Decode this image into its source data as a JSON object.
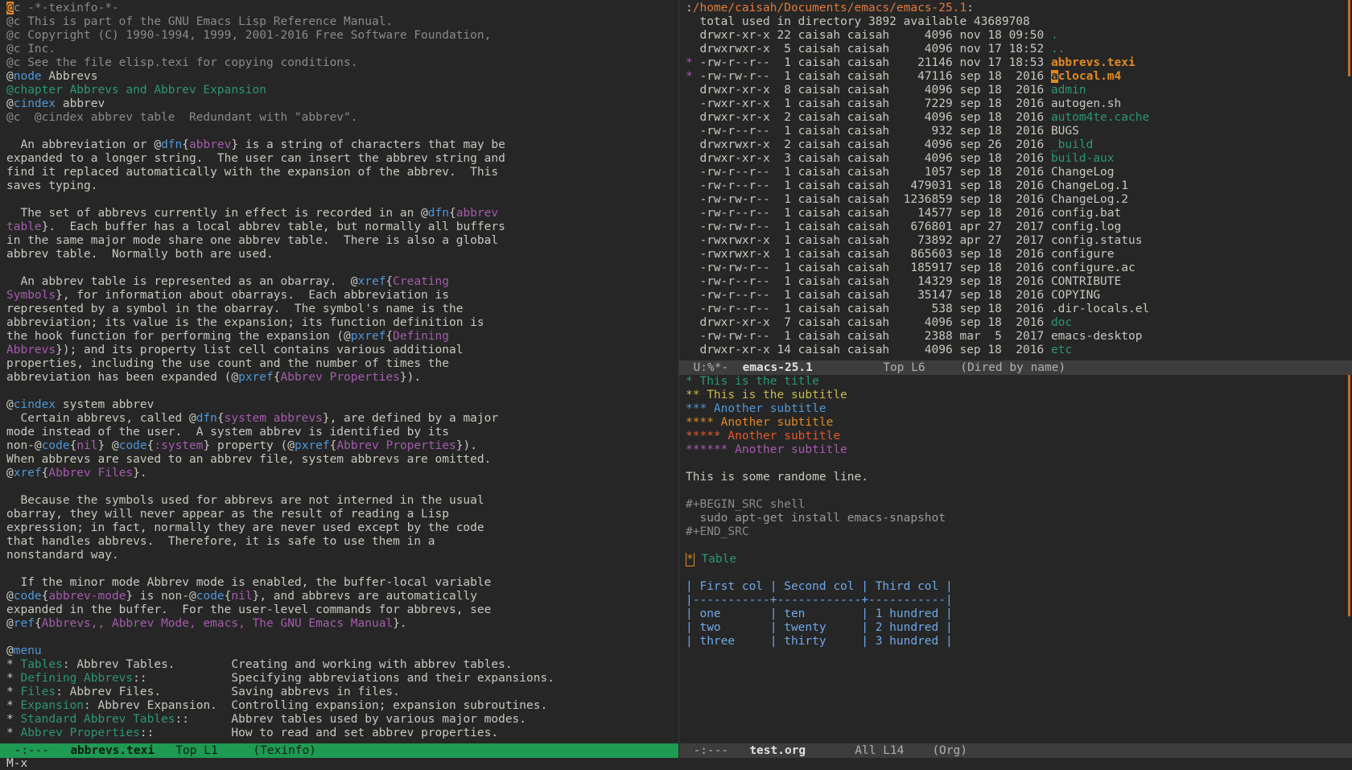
{
  "left_buffer": {
    "lines": [
      [
        [
          "@",
          "c-cursor"
        ],
        [
          "c -*-texinfo-*-",
          "c-comment"
        ]
      ],
      [
        [
          "@c This is part of the GNU Emacs Lisp Reference Manual.",
          "c-comment"
        ]
      ],
      [
        [
          "@c Copyright (C) 1990-1994, 1999, 2001-2016 Free Software Foundation,",
          "c-comment"
        ]
      ],
      [
        [
          "@c Inc.",
          "c-comment"
        ]
      ],
      [
        [
          "@c See the file elisp.texi for copying conditions.",
          "c-comment"
        ]
      ],
      [
        [
          "@",
          ""
        ],
        [
          "node",
          "c-kw"
        ],
        [
          " Abbrevs",
          ""
        ]
      ],
      [
        [
          "@chapter Abbrevs and Abbrev Expansion",
          "c-green"
        ]
      ],
      [
        [
          "@",
          ""
        ],
        [
          "cindex",
          "c-kw"
        ],
        [
          " abbrev",
          ""
        ]
      ],
      [
        [
          "@c  @cindex abbrev table  Redundant with \"abbrev\".",
          "c-comment"
        ]
      ],
      [
        [
          "",
          ""
        ]
      ],
      [
        [
          "  An abbreviation or @",
          ""
        ],
        [
          "dfn",
          "c-kw"
        ],
        [
          "{",
          ""
        ],
        [
          "abbrev",
          "c-purple"
        ],
        [
          "} is a string of characters that may be",
          ""
        ]
      ],
      [
        [
          "expanded to a longer string.  The user can insert the abbrev string and",
          ""
        ]
      ],
      [
        [
          "find it replaced automatically with the expansion of the abbrev.  This",
          ""
        ]
      ],
      [
        [
          "saves typing.",
          ""
        ]
      ],
      [
        [
          "",
          ""
        ]
      ],
      [
        [
          "  The set of abbrevs currently in effect is recorded in an @",
          ""
        ],
        [
          "dfn",
          "c-kw"
        ],
        [
          "{",
          ""
        ],
        [
          "abbrev",
          "c-purple"
        ]
      ],
      [
        [
          "table",
          "c-purple"
        ],
        [
          "}.  Each buffer has a local abbrev table, but normally all buffers",
          ""
        ]
      ],
      [
        [
          "in the same major mode share one abbrev table.  There is also a global",
          ""
        ]
      ],
      [
        [
          "abbrev table.  Normally both are used.",
          ""
        ]
      ],
      [
        [
          "",
          ""
        ]
      ],
      [
        [
          "  An abbrev table is represented as an obarray.  @",
          ""
        ],
        [
          "xref",
          "c-kw"
        ],
        [
          "{",
          ""
        ],
        [
          "Creating",
          "c-purple"
        ]
      ],
      [
        [
          "Symbols",
          "c-purple"
        ],
        [
          "}, for information about obarrays.  Each abbreviation is",
          ""
        ]
      ],
      [
        [
          "represented by a symbol in the obarray.  The symbol's name is the",
          ""
        ]
      ],
      [
        [
          "abbreviation; its value is the expansion; its function definition is",
          ""
        ]
      ],
      [
        [
          "the hook function for performing the expansion (@",
          ""
        ],
        [
          "pxref",
          "c-kw"
        ],
        [
          "{",
          ""
        ],
        [
          "Defining",
          "c-purple"
        ]
      ],
      [
        [
          "Abbrevs",
          "c-purple"
        ],
        [
          "}); and its property list cell contains various additional",
          ""
        ]
      ],
      [
        [
          "properties, including the use count and the number of times the",
          ""
        ]
      ],
      [
        [
          "abbreviation has been expanded (@",
          ""
        ],
        [
          "pxref",
          "c-kw"
        ],
        [
          "{",
          ""
        ],
        [
          "Abbrev Properties",
          "c-purple"
        ],
        [
          "}).",
          ""
        ]
      ],
      [
        [
          "",
          ""
        ]
      ],
      [
        [
          "@",
          ""
        ],
        [
          "cindex",
          "c-kw"
        ],
        [
          " system abbrev",
          ""
        ]
      ],
      [
        [
          "  Certain abbrevs, called @",
          ""
        ],
        [
          "dfn",
          "c-kw"
        ],
        [
          "{",
          ""
        ],
        [
          "system abbrevs",
          "c-purple"
        ],
        [
          "}, are defined by a major",
          ""
        ]
      ],
      [
        [
          "mode instead of the user.  A system abbrev is identified by its",
          ""
        ]
      ],
      [
        [
          "non-@",
          ""
        ],
        [
          "code",
          "c-kw"
        ],
        [
          "{",
          ""
        ],
        [
          "nil",
          "c-purple"
        ],
        [
          "} @",
          ""
        ],
        [
          "code",
          "c-kw"
        ],
        [
          "{",
          ""
        ],
        [
          ":system",
          "c-purple"
        ],
        [
          "} property (@",
          ""
        ],
        [
          "pxref",
          "c-kw"
        ],
        [
          "{",
          ""
        ],
        [
          "Abbrev Properties",
          "c-purple"
        ],
        [
          "}).",
          ""
        ]
      ],
      [
        [
          "When abbrevs are saved to an abbrev file, system abbrevs are omitted.",
          ""
        ]
      ],
      [
        [
          "@",
          ""
        ],
        [
          "xref",
          "c-kw"
        ],
        [
          "{",
          ""
        ],
        [
          "Abbrev Files",
          "c-purple"
        ],
        [
          "}.",
          ""
        ]
      ],
      [
        [
          "",
          ""
        ]
      ],
      [
        [
          "  Because the symbols used for abbrevs are not interned in the usual",
          ""
        ]
      ],
      [
        [
          "obarray, they will never appear as the result of reading a Lisp",
          ""
        ]
      ],
      [
        [
          "expression; in fact, normally they are never used except by the code",
          ""
        ]
      ],
      [
        [
          "that handles abbrevs.  Therefore, it is safe to use them in a",
          ""
        ]
      ],
      [
        [
          "nonstandard way.",
          ""
        ]
      ],
      [
        [
          "",
          ""
        ]
      ],
      [
        [
          "  If the minor mode Abbrev mode is enabled, the buffer-local variable",
          ""
        ]
      ],
      [
        [
          "@",
          ""
        ],
        [
          "code",
          "c-kw"
        ],
        [
          "{",
          ""
        ],
        [
          "abbrev-mode",
          "c-purple"
        ],
        [
          "} is non-@",
          ""
        ],
        [
          "code",
          "c-kw"
        ],
        [
          "{",
          ""
        ],
        [
          "nil",
          "c-purple"
        ],
        [
          "}, and abbrevs are automatically",
          ""
        ]
      ],
      [
        [
          "expanded in the buffer.  For the user-level commands for abbrevs, see",
          ""
        ]
      ],
      [
        [
          "@",
          ""
        ],
        [
          "ref",
          "c-kw"
        ],
        [
          "{",
          ""
        ],
        [
          "Abbrevs,, Abbrev Mode, emacs, The GNU Emacs Manual",
          "c-purple"
        ],
        [
          "}.",
          ""
        ]
      ],
      [
        [
          "",
          ""
        ]
      ],
      [
        [
          "@",
          ""
        ],
        [
          "menu",
          "c-kw"
        ]
      ],
      [
        [
          "* ",
          ""
        ],
        [
          "Tables",
          "c-green"
        ],
        [
          ": Abbrev Tables.        Creating and working with abbrev tables.",
          ""
        ]
      ],
      [
        [
          "* ",
          ""
        ],
        [
          "Defining Abbrevs",
          "c-green"
        ],
        [
          "::            Specifying abbreviations and their expansions.",
          ""
        ]
      ],
      [
        [
          "* ",
          ""
        ],
        [
          "Files",
          "c-green"
        ],
        [
          ": Abbrev Files.          Saving abbrevs in files.",
          ""
        ]
      ],
      [
        [
          "* ",
          ""
        ],
        [
          "Expansion",
          "c-green"
        ],
        [
          ": Abbrev Expansion.  Controlling expansion; expansion subroutines.",
          ""
        ]
      ],
      [
        [
          "* ",
          ""
        ],
        [
          "Standard Abbrev Tables",
          "c-green"
        ],
        [
          "::      Abbrev tables used by various major modes.",
          ""
        ]
      ],
      [
        [
          "* ",
          ""
        ],
        [
          "Abbrev Properties",
          "c-green"
        ],
        [
          "::           How to read and set abbrev properties.",
          ""
        ]
      ]
    ]
  },
  "dired_buffer": {
    "path": "/home/caisah/Documents/emacs/emacs-25.1",
    "summary": "total used in directory 3892 available 43689708",
    "entries": [
      {
        "mark": " ",
        "perm": "drwxr-xr-x",
        "links": "22",
        "user": "caisah",
        "group": "caisah",
        "size": "4096",
        "mon": "nov",
        "day": "18",
        "time": "09:50",
        "name": ".",
        "cls": "c-dir"
      },
      {
        "mark": " ",
        "perm": "drwxrwxr-x",
        "links": "5",
        "user": "caisah",
        "group": "caisah",
        "size": "4096",
        "mon": "nov",
        "day": "17",
        "time": "18:52",
        "name": "..",
        "cls": "c-dir"
      },
      {
        "mark": "*",
        "perm": "-rw-r--r--",
        "links": "1",
        "user": "caisah",
        "group": "caisah",
        "size": "21146",
        "mon": "nov",
        "day": "17",
        "time": "18:53",
        "name": "abbrevs.texi",
        "cls": "c-mod"
      },
      {
        "mark": "*",
        "perm": "-rw-rw-r--",
        "links": "1",
        "user": "caisah",
        "group": "caisah",
        "size": "47116",
        "mon": "sep",
        "day": "18",
        "time": "2016",
        "name": "aclocal.m4",
        "cls": "c-mod"
      },
      {
        "mark": " ",
        "perm": "drwxr-xr-x",
        "links": "8",
        "user": "caisah",
        "group": "caisah",
        "size": "4096",
        "mon": "sep",
        "day": "18",
        "time": "2016",
        "name": "admin",
        "cls": "c-dir"
      },
      {
        "mark": " ",
        "perm": "-rwxr-xr-x",
        "links": "1",
        "user": "caisah",
        "group": "caisah",
        "size": "7229",
        "mon": "sep",
        "day": "18",
        "time": "2016",
        "name": "autogen.sh",
        "cls": ""
      },
      {
        "mark": " ",
        "perm": "drwxr-xr-x",
        "links": "2",
        "user": "caisah",
        "group": "caisah",
        "size": "4096",
        "mon": "sep",
        "day": "18",
        "time": "2016",
        "name": "autom4te.cache",
        "cls": "c-dir"
      },
      {
        "mark": " ",
        "perm": "-rw-r--r--",
        "links": "1",
        "user": "caisah",
        "group": "caisah",
        "size": "932",
        "mon": "sep",
        "day": "18",
        "time": "2016",
        "name": "BUGS",
        "cls": ""
      },
      {
        "mark": " ",
        "perm": "drwxrwxr-x",
        "links": "2",
        "user": "caisah",
        "group": "caisah",
        "size": "4096",
        "mon": "sep",
        "day": "26",
        "time": "2016",
        "name": "_build",
        "cls": "c-dir"
      },
      {
        "mark": " ",
        "perm": "drwxr-xr-x",
        "links": "3",
        "user": "caisah",
        "group": "caisah",
        "size": "4096",
        "mon": "sep",
        "day": "18",
        "time": "2016",
        "name": "build-aux",
        "cls": "c-dir"
      },
      {
        "mark": " ",
        "perm": "-rw-r--r--",
        "links": "1",
        "user": "caisah",
        "group": "caisah",
        "size": "1057",
        "mon": "sep",
        "day": "18",
        "time": "2016",
        "name": "ChangeLog",
        "cls": ""
      },
      {
        "mark": " ",
        "perm": "-rw-r--r--",
        "links": "1",
        "user": "caisah",
        "group": "caisah",
        "size": "479031",
        "mon": "sep",
        "day": "18",
        "time": "2016",
        "name": "ChangeLog.1",
        "cls": ""
      },
      {
        "mark": " ",
        "perm": "-rw-rw-r--",
        "links": "1",
        "user": "caisah",
        "group": "caisah",
        "size": "1236859",
        "mon": "sep",
        "day": "18",
        "time": "2016",
        "name": "ChangeLog.2",
        "cls": ""
      },
      {
        "mark": " ",
        "perm": "-rw-r--r--",
        "links": "1",
        "user": "caisah",
        "group": "caisah",
        "size": "14577",
        "mon": "sep",
        "day": "18",
        "time": "2016",
        "name": "config.bat",
        "cls": ""
      },
      {
        "mark": " ",
        "perm": "-rw-rw-r--",
        "links": "1",
        "user": "caisah",
        "group": "caisah",
        "size": "676801",
        "mon": "apr",
        "day": "27",
        "time": "2017",
        "name": "config.log",
        "cls": ""
      },
      {
        "mark": " ",
        "perm": "-rwxrwxr-x",
        "links": "1",
        "user": "caisah",
        "group": "caisah",
        "size": "73892",
        "mon": "apr",
        "day": "27",
        "time": "2017",
        "name": "config.status",
        "cls": ""
      },
      {
        "mark": " ",
        "perm": "-rwxrwxr-x",
        "links": "1",
        "user": "caisah",
        "group": "caisah",
        "size": "865603",
        "mon": "sep",
        "day": "18",
        "time": "2016",
        "name": "configure",
        "cls": ""
      },
      {
        "mark": " ",
        "perm": "-rw-rw-r--",
        "links": "1",
        "user": "caisah",
        "group": "caisah",
        "size": "185917",
        "mon": "sep",
        "day": "18",
        "time": "2016",
        "name": "configure.ac",
        "cls": ""
      },
      {
        "mark": " ",
        "perm": "-rw-r--r--",
        "links": "1",
        "user": "caisah",
        "group": "caisah",
        "size": "14329",
        "mon": "sep",
        "day": "18",
        "time": "2016",
        "name": "CONTRIBUTE",
        "cls": ""
      },
      {
        "mark": " ",
        "perm": "-rw-r--r--",
        "links": "1",
        "user": "caisah",
        "group": "caisah",
        "size": "35147",
        "mon": "sep",
        "day": "18",
        "time": "2016",
        "name": "COPYING",
        "cls": ""
      },
      {
        "mark": " ",
        "perm": "-rw-r--r--",
        "links": "1",
        "user": "caisah",
        "group": "caisah",
        "size": "538",
        "mon": "sep",
        "day": "18",
        "time": "2016",
        "name": ".dir-locals.el",
        "cls": ""
      },
      {
        "mark": " ",
        "perm": "drwxr-xr-x",
        "links": "7",
        "user": "caisah",
        "group": "caisah",
        "size": "4096",
        "mon": "sep",
        "day": "18",
        "time": "2016",
        "name": "doc",
        "cls": "c-dir"
      },
      {
        "mark": " ",
        "perm": "-rw-rw-r--",
        "links": "1",
        "user": "caisah",
        "group": "caisah",
        "size": "2388",
        "mon": "mar",
        "day": "5",
        "time": "2017",
        "name": "emacs-desktop",
        "cls": ""
      },
      {
        "mark": " ",
        "perm": "drwxr-xr-x",
        "links": "14",
        "user": "caisah",
        "group": "caisah",
        "size": "4096",
        "mon": "sep",
        "day": "18",
        "time": "2016",
        "name": "etc",
        "cls": "c-dir"
      }
    ]
  },
  "org_buffer": {
    "lines": [
      [
        [
          "* This is the title",
          "org1"
        ]
      ],
      [
        [
          "** This is the subtitle",
          "org2"
        ]
      ],
      [
        [
          "*** Another subtitle",
          "org3"
        ]
      ],
      [
        [
          "**** Another subtitle",
          "org4"
        ]
      ],
      [
        [
          "***** Another subtitle",
          "org5"
        ]
      ],
      [
        [
          "****** Another subtitle",
          "org6"
        ]
      ],
      [
        [
          "",
          ""
        ]
      ],
      [
        [
          "This is some randome line.",
          ""
        ]
      ],
      [
        [
          "",
          ""
        ]
      ],
      [
        [
          "#+BEGIN_SRC shell",
          "org-meta"
        ]
      ],
      [
        [
          "  sudo apt-get install emacs-snapshot",
          "org-src"
        ]
      ],
      [
        [
          "#+END_SRC",
          "org-meta"
        ]
      ],
      [
        [
          "",
          ""
        ]
      ],
      [
        [
          "*",
          "org-todo"
        ],
        [
          " Table",
          "org1"
        ]
      ],
      [
        [
          "",
          ""
        ]
      ],
      [
        [
          "| First col | Second col | Third col |",
          "org-table"
        ]
      ],
      [
        [
          "|-----------+------------+-----------|",
          "org-table"
        ]
      ],
      [
        [
          "| one       | ten        | 1 hundred |",
          "org-table"
        ]
      ],
      [
        [
          "| two       | twenty     | 2 hundred |",
          "org-table"
        ]
      ],
      [
        [
          "| three     | thirty     | 3 hundred |",
          "org-table"
        ]
      ]
    ]
  },
  "modelines": {
    "left": {
      "state": "-:---",
      "buffer": "abbrevs.texi",
      "position": "Top L1",
      "mode": "(Texinfo)"
    },
    "dired": {
      "state": "U:%*-",
      "buffer": "emacs-25.1",
      "position": "Top L6",
      "mode": "(Dired by name)"
    },
    "org": {
      "state": "-:---",
      "buffer": "test.org",
      "position": "All L14",
      "mode": "(Org)"
    }
  },
  "minibuffer": "M-x",
  "colors": {
    "background": "#262626",
    "active_modeline": "#1e9a53",
    "inactive_modeline": "#3d3d3d",
    "accent": "#e08a20",
    "scrollbar": "#c86a2a"
  }
}
